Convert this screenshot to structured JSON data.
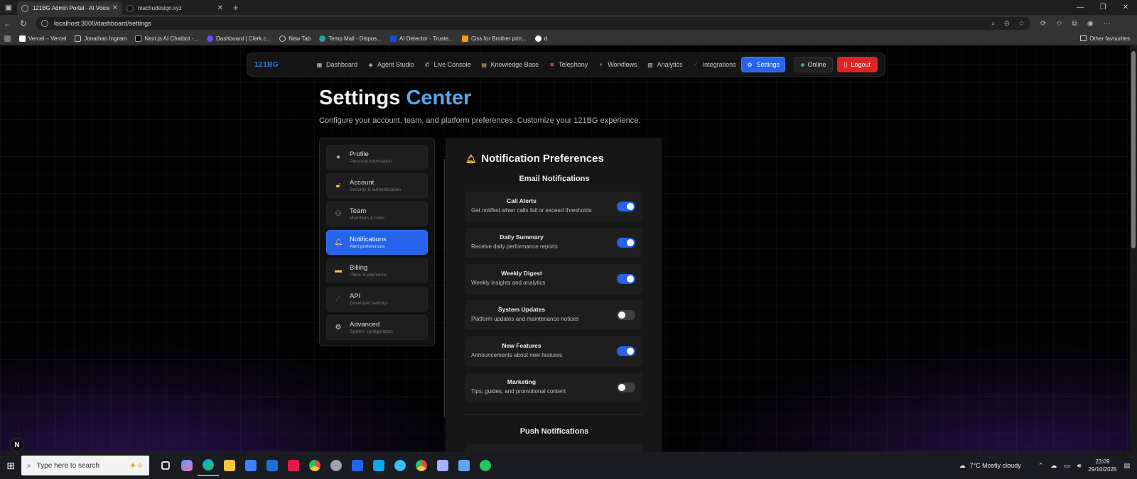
{
  "browser": {
    "tabs": [
      {
        "title": "121BG Admin Portal - AI Voice A",
        "active": true
      },
      {
        "title": "machudesign.xyz",
        "active": false
      }
    ],
    "url": "localhost:3000/dashboard/settings",
    "bookmarks": [
      "Vercel – Vercel",
      "Jonathan Ingram",
      "Next.js AI Chatbot -...",
      "Dashboard | Clerk.c...",
      "New Tab",
      "Temp Mail - Dispos...",
      "AI Detector - Truste...",
      "Ciss for Brother prin...",
      "d"
    ],
    "other_favourites": "Other favourites"
  },
  "nav": {
    "brand": "121BG",
    "items": [
      {
        "label": "Dashboard",
        "icon": "chart-icon"
      },
      {
        "label": "Agent Studio",
        "icon": "robot-icon"
      },
      {
        "label": "Live Console",
        "icon": "phone-icon"
      },
      {
        "label": "Knowledge Base",
        "icon": "book-icon"
      },
      {
        "label": "Telephony",
        "icon": "phone-x-icon"
      },
      {
        "label": "Workflows",
        "icon": "bolt-icon"
      },
      {
        "label": "Analytics",
        "icon": "analytics-icon"
      },
      {
        "label": "Integrations",
        "icon": "link-icon"
      },
      {
        "label": "Settings",
        "icon": "gear-icon",
        "active": true
      }
    ],
    "online_label": "Online",
    "logout_label": "Logout"
  },
  "header": {
    "title_main": "Settings",
    "title_accent": "Center",
    "subtitle": "Configure your account, team, and platform preferences. Customize your 121BG experience."
  },
  "sidebar": {
    "items": [
      {
        "label": "Profile",
        "sub": "Personal information",
        "icon": "user-icon"
      },
      {
        "label": "Account",
        "sub": "Security & authentication",
        "icon": "lock-icon"
      },
      {
        "label": "Team",
        "sub": "Members & roles",
        "icon": "team-icon"
      },
      {
        "label": "Notifications",
        "sub": "Alert preferences",
        "icon": "bell-icon",
        "active": true
      },
      {
        "label": "Billing",
        "sub": "Plans & payments",
        "icon": "card-icon"
      },
      {
        "label": "API",
        "sub": "Developer settings",
        "icon": "wrench-icon"
      },
      {
        "label": "Advanced",
        "sub": "System configuration",
        "icon": "gear-icon"
      }
    ]
  },
  "notifications": {
    "title": "Notification Preferences",
    "email_heading": "Email Notifications",
    "push_heading": "Push Notifications",
    "email_items": [
      {
        "title": "Call Alerts",
        "desc": "Get notified when calls fail or exceed thresholds",
        "enabled": true
      },
      {
        "title": "Daily Summary",
        "desc": "Receive daily performance reports",
        "enabled": true
      },
      {
        "title": "Weekly Digest",
        "desc": "Weekly insights and analytics",
        "enabled": true
      },
      {
        "title": "System Updates",
        "desc": "Platform updates and maintenance notices",
        "enabled": false
      },
      {
        "title": "New Features",
        "desc": "Announcements about new features",
        "enabled": true
      },
      {
        "title": "Marketing",
        "desc": "Tips, guides, and promotional content",
        "enabled": false
      }
    ]
  },
  "taskbar": {
    "search_placeholder": "Type here to search",
    "weather": "7°C  Mostly cloudy",
    "time": "23:09",
    "date": "29/10/2025"
  },
  "colors": {
    "accent": "#2563eb",
    "logout": "#dc2626",
    "online": "#22c55e",
    "title_accent": "#5aa8e6"
  }
}
